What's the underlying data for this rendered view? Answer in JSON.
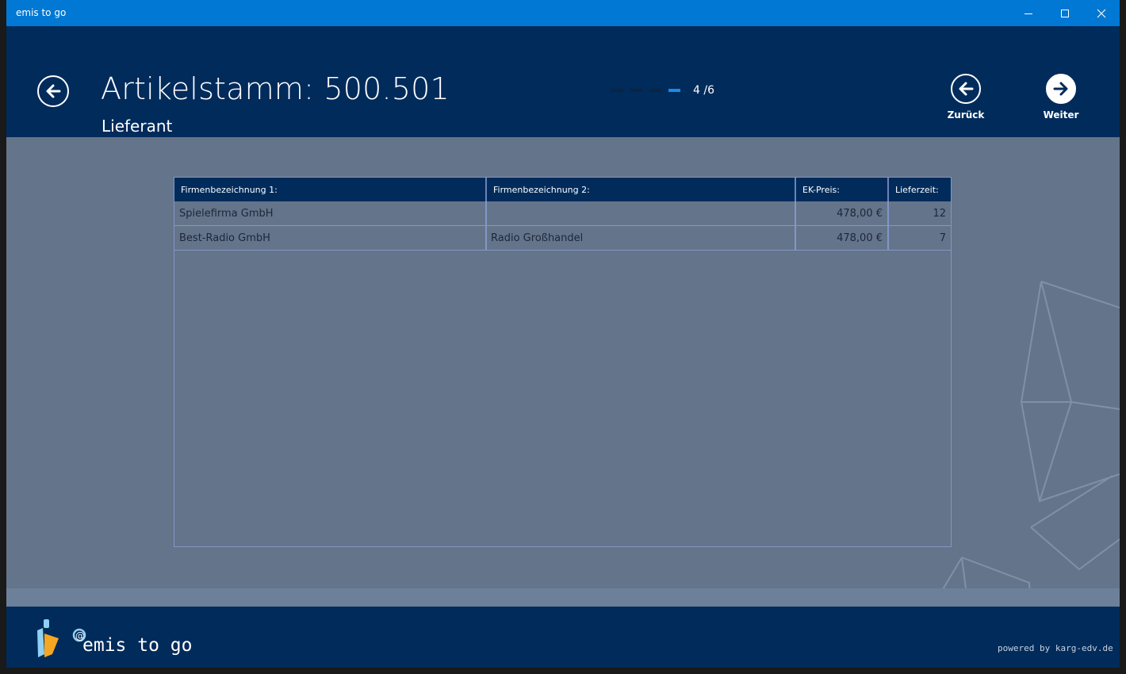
{
  "window": {
    "title": "emis to go"
  },
  "header": {
    "title": "Artikelstamm: 500.501",
    "subtitle": "Lieferant",
    "pager": {
      "current": 4,
      "total": 6,
      "text": "4 /6"
    },
    "back_label": "Zurück",
    "next_label": "Weiter"
  },
  "table": {
    "columns": [
      "Firmenbezeichnung 1:",
      "Firmenbezeichnung 2:",
      "EK-Preis:",
      "Lieferzeit:"
    ],
    "rows": [
      [
        "Spielefirma GmbH",
        "",
        "478,00 €",
        "12"
      ],
      [
        "Best-Radio GmbH",
        "Radio Großhandel",
        "478,00 €",
        "7"
      ]
    ]
  },
  "footer": {
    "brand": "emis to go",
    "powered": "powered by karg-edv.de"
  },
  "colors": {
    "titlebar": "#0078d4",
    "header": "#002b5b",
    "content": "#64748a",
    "accent": "#1e88e5"
  }
}
